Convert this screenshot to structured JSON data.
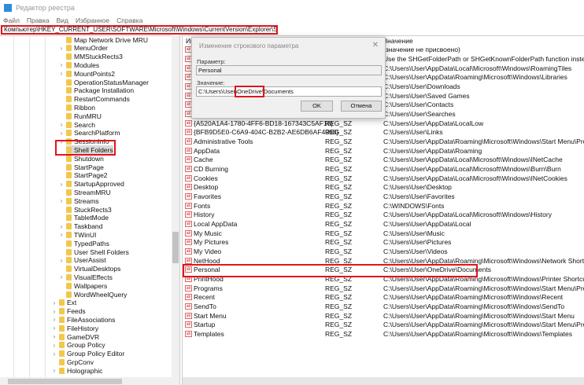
{
  "window": {
    "title": "Редактор реестра"
  },
  "menu": [
    "Файл",
    "Правка",
    "Вид",
    "Избранное",
    "Справка"
  ],
  "address": "Компьютер\\HKEY_CURRENT_USER\\SOFTWARE\\Microsoft\\Windows\\CurrentVersion\\Explorer\\Shell Folders",
  "tree": [
    {
      "label": "Map Network Drive MRU",
      "level": 2,
      "expandable": false
    },
    {
      "label": "MenuOrder",
      "level": 2,
      "expandable": true
    },
    {
      "label": "MMStuckRects3",
      "level": 2,
      "expandable": false
    },
    {
      "label": "Modules",
      "level": 2,
      "expandable": true
    },
    {
      "label": "MountPoints2",
      "level": 2,
      "expandable": true
    },
    {
      "label": "OperationStatusManager",
      "level": 2,
      "expandable": false
    },
    {
      "label": "Package Installation",
      "level": 2,
      "expandable": false
    },
    {
      "label": "RestartCommands",
      "level": 2,
      "expandable": false
    },
    {
      "label": "Ribbon",
      "level": 2,
      "expandable": false
    },
    {
      "label": "RunMRU",
      "level": 2,
      "expandable": false
    },
    {
      "label": "Search",
      "level": 2,
      "expandable": true
    },
    {
      "label": "SearchPlatform",
      "level": 2,
      "expandable": true
    },
    {
      "label": "SessionInfo",
      "level": 2,
      "expandable": true
    },
    {
      "label": "Shell Folders",
      "level": 2,
      "expandable": false,
      "selected": true
    },
    {
      "label": "Shutdown",
      "level": 2,
      "expandable": false
    },
    {
      "label": "StartPage",
      "level": 2,
      "expandable": false
    },
    {
      "label": "StartPage2",
      "level": 2,
      "expandable": false
    },
    {
      "label": "StartupApproved",
      "level": 2,
      "expandable": true
    },
    {
      "label": "StreamMRU",
      "level": 2,
      "expandable": false
    },
    {
      "label": "Streams",
      "level": 2,
      "expandable": true
    },
    {
      "label": "StuckRects3",
      "level": 2,
      "expandable": false
    },
    {
      "label": "TabletMode",
      "level": 2,
      "expandable": false
    },
    {
      "label": "Taskband",
      "level": 2,
      "expandable": true
    },
    {
      "label": "TWinUI",
      "level": 2,
      "expandable": true
    },
    {
      "label": "TypedPaths",
      "level": 2,
      "expandable": false
    },
    {
      "label": "User Shell Folders",
      "level": 2,
      "expandable": false
    },
    {
      "label": "UserAssist",
      "level": 2,
      "expandable": true
    },
    {
      "label": "VirtualDesktops",
      "level": 2,
      "expandable": false
    },
    {
      "label": "VisualEffects",
      "level": 2,
      "expandable": true
    },
    {
      "label": "Wallpapers",
      "level": 2,
      "expandable": false
    },
    {
      "label": "WordWheelQuery",
      "level": 2,
      "expandable": false
    },
    {
      "label": "Ext",
      "level": 1,
      "expandable": true
    },
    {
      "label": "Feeds",
      "level": 1,
      "expandable": true
    },
    {
      "label": "FileAssociations",
      "level": 1,
      "expandable": true
    },
    {
      "label": "FileHistory",
      "level": 1,
      "expandable": true
    },
    {
      "label": "GameDVR",
      "level": 1,
      "expandable": true
    },
    {
      "label": "Group Policy",
      "level": 1,
      "expandable": true
    },
    {
      "label": "Group Policy Editor",
      "level": 1,
      "expandable": true
    },
    {
      "label": "GrpConv",
      "level": 1,
      "expandable": false
    },
    {
      "label": "Holographic",
      "level": 1,
      "expandable": true
    }
  ],
  "list": {
    "headers": {
      "name": "Имя",
      "value": "Значение"
    },
    "rows": [
      {
        "name": "",
        "type": "",
        "value": "(значение не присвоено)"
      },
      {
        "name": "",
        "type": "",
        "value": "Use the SHGetFolderPath or SHGetKnownFolderPath function instead"
      },
      {
        "name": "",
        "type": "",
        "value": "C:\\Users\\User\\AppData\\Local\\Microsoft\\Windows\\RoamingTiles"
      },
      {
        "name": "",
        "type": "",
        "value": "C:\\Users\\User\\AppData\\Roaming\\Microsoft\\Windows\\Libraries"
      },
      {
        "name": "",
        "type": "",
        "value": "C:\\Users\\User\\Downloads"
      },
      {
        "name": "",
        "type": "",
        "value": "C:\\Users\\User\\Saved Games"
      },
      {
        "name": "",
        "type": "",
        "value": "C:\\Users\\User\\Contacts"
      },
      {
        "name": "",
        "type": "",
        "value": "C:\\Users\\User\\Searches"
      },
      {
        "name": "{A520A1A4-1780-4FF6-BD18-167343C5AF16}",
        "type": "REG_SZ",
        "value": "C:\\Users\\User\\AppData\\LocalLow"
      },
      {
        "name": "{BFB9D5E0-C6A9-404C-B2B2-AE6DB6AF4968}",
        "type": "REG_SZ",
        "value": "C:\\Users\\User\\Links"
      },
      {
        "name": "Administrative Tools",
        "type": "REG_SZ",
        "value": "C:\\Users\\User\\AppData\\Roaming\\Microsoft\\Windows\\Start Menu\\Programs\\Administrative Tools"
      },
      {
        "name": "AppData",
        "type": "REG_SZ",
        "value": "C:\\Users\\User\\AppData\\Roaming"
      },
      {
        "name": "Cache",
        "type": "REG_SZ",
        "value": "C:\\Users\\User\\AppData\\Local\\Microsoft\\Windows\\INetCache"
      },
      {
        "name": "CD Burning",
        "type": "REG_SZ",
        "value": "C:\\Users\\User\\AppData\\Local\\Microsoft\\Windows\\Burn\\Burn"
      },
      {
        "name": "Cookies",
        "type": "REG_SZ",
        "value": "C:\\Users\\User\\AppData\\Local\\Microsoft\\Windows\\INetCookies"
      },
      {
        "name": "Desktop",
        "type": "REG_SZ",
        "value": "C:\\Users\\User\\Desktop"
      },
      {
        "name": "Favorites",
        "type": "REG_SZ",
        "value": "C:\\Users\\User\\Favorites"
      },
      {
        "name": "Fonts",
        "type": "REG_SZ",
        "value": "C:\\WINDOWS\\Fonts"
      },
      {
        "name": "History",
        "type": "REG_SZ",
        "value": "C:\\Users\\User\\AppData\\Local\\Microsoft\\Windows\\History"
      },
      {
        "name": "Local AppData",
        "type": "REG_SZ",
        "value": "C:\\Users\\User\\AppData\\Local"
      },
      {
        "name": "My Music",
        "type": "REG_SZ",
        "value": "C:\\Users\\User\\Music"
      },
      {
        "name": "My Pictures",
        "type": "REG_SZ",
        "value": "C:\\Users\\User\\Pictures"
      },
      {
        "name": "My Video",
        "type": "REG_SZ",
        "value": "C:\\Users\\User\\Videos"
      },
      {
        "name": "NetHood",
        "type": "REG_SZ",
        "value": "C:\\Users\\User\\AppData\\Roaming\\Microsoft\\Windows\\Network Shortcuts"
      },
      {
        "name": "Personal",
        "type": "REG_SZ",
        "value": "C:\\Users\\User\\OneDrive\\Documents",
        "highlighted": true
      },
      {
        "name": "PrintHood",
        "type": "REG_SZ",
        "value": "C:\\Users\\User\\AppData\\Roaming\\Microsoft\\Windows\\Printer Shortcuts"
      },
      {
        "name": "Programs",
        "type": "REG_SZ",
        "value": "C:\\Users\\User\\AppData\\Roaming\\Microsoft\\Windows\\Start Menu\\Programs"
      },
      {
        "name": "Recent",
        "type": "REG_SZ",
        "value": "C:\\Users\\User\\AppData\\Roaming\\Microsoft\\Windows\\Recent"
      },
      {
        "name": "SendTo",
        "type": "REG_SZ",
        "value": "C:\\Users\\User\\AppData\\Roaming\\Microsoft\\Windows\\SendTo"
      },
      {
        "name": "Start Menu",
        "type": "REG_SZ",
        "value": "C:\\Users\\User\\AppData\\Roaming\\Microsoft\\Windows\\Start Menu"
      },
      {
        "name": "Startup",
        "type": "REG_SZ",
        "value": "C:\\Users\\User\\AppData\\Roaming\\Microsoft\\Windows\\Start Menu\\Programs\\Startup"
      },
      {
        "name": "Templates",
        "type": "REG_SZ",
        "value": "C:\\Users\\User\\AppData\\Roaming\\Microsoft\\Windows\\Templates"
      }
    ]
  },
  "dialog": {
    "title": "Изменение строкового параметра",
    "param_label": "Параметр:",
    "param_value": "Personal",
    "value_label": "Значение:",
    "value_parts": [
      "C:\\Users\\User\\",
      "OneDrive",
      "\\Documents"
    ],
    "ok": "OK",
    "cancel": "Отмена"
  },
  "colors": {
    "highlight": "#e0151b",
    "folder": "#f3c74a",
    "accent": "#2a8fd6"
  }
}
